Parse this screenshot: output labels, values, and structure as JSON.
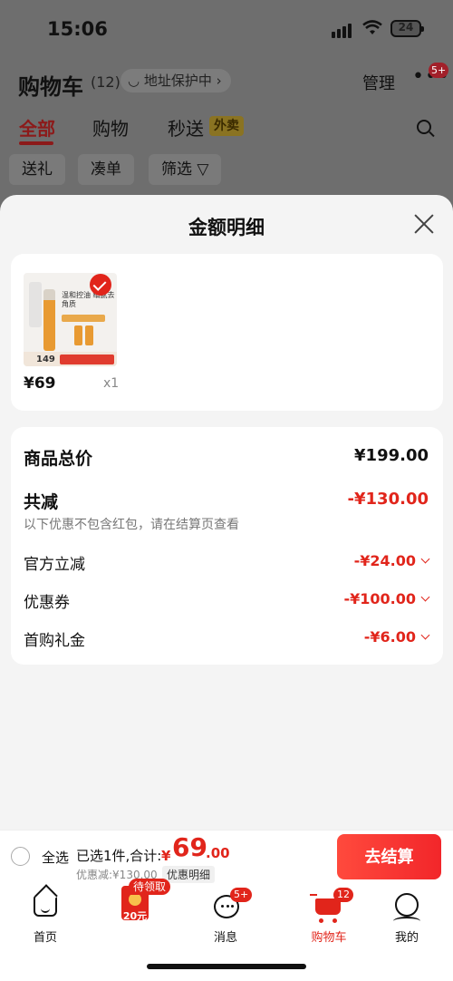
{
  "status_bar": {
    "time": "15:06",
    "battery": "24"
  },
  "cart_header": {
    "title": "购物车",
    "count": "(12)",
    "address_protect": "地址保护中",
    "manage": "管理",
    "more_badge": "5+"
  },
  "tabs": [
    {
      "label": "全部",
      "active": true
    },
    {
      "label": "购物",
      "active": false
    },
    {
      "label": "秒送",
      "active": false
    }
  ],
  "waimai_tag": "外卖",
  "filter_chips": [
    "送礼",
    "凑单",
    "筛选"
  ],
  "sheet": {
    "title": "金额明细",
    "item": {
      "image_caption": "温和控油 细腻去角质",
      "image_price": "149",
      "price": "¥69",
      "qty": "x1"
    },
    "summary": {
      "total_label": "商品总价",
      "total_value": "¥199.00",
      "reduction_label": "共减",
      "reduction_value": "-¥130.00",
      "note": "以下优惠不包含红包，请在结算页查看",
      "rows": [
        {
          "label": "官方立减",
          "value": "-¥24.00"
        },
        {
          "label": "优惠券",
          "value": "-¥100.00"
        },
        {
          "label": "首购礼金",
          "value": "-¥6.00"
        }
      ]
    }
  },
  "checkout": {
    "select_all": "全选",
    "selected_text": "已选1件,合计:",
    "currency": "¥",
    "total_int": "69",
    "total_dec": ".00",
    "discount_text": "优惠减:¥130.00",
    "detail_link": "优惠明细",
    "pay_button": "去结算"
  },
  "tab_bar": {
    "home": "首页",
    "pending_badge": "待领取",
    "redpacket_amount": "20元",
    "messages": "消息",
    "messages_badge": "5+",
    "cart": "购物车",
    "cart_badge": "12",
    "me": "我的"
  },
  "colors": {
    "accent": "#e1251b",
    "dim_overlay": "#6e6e6e",
    "sheet_bg": "#f4f4f4"
  }
}
